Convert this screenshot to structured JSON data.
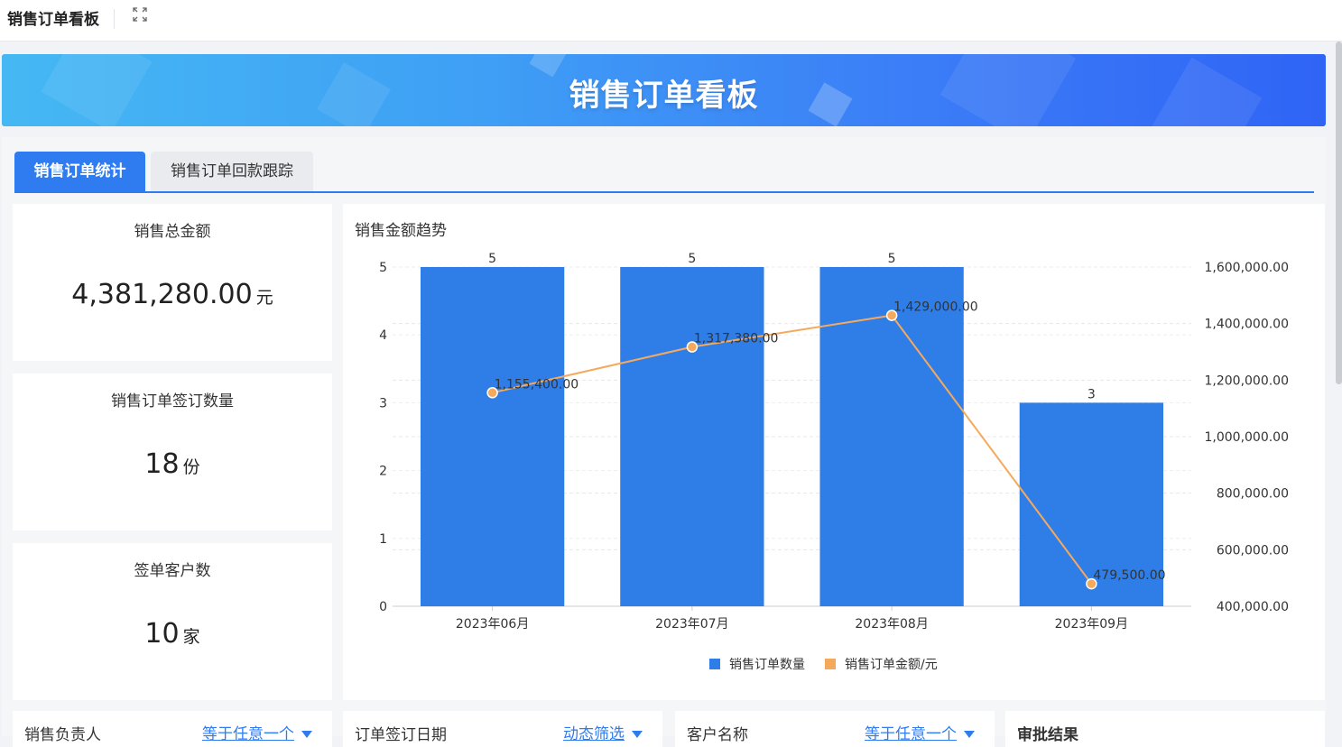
{
  "app_title": "销售订单看板",
  "banner_title": "销售订单看板",
  "tabs": [
    {
      "label": "销售订单统计",
      "active": true
    },
    {
      "label": "销售订单回款跟踪",
      "active": false
    }
  ],
  "kpis": [
    {
      "label": "销售总金额",
      "value": "4,381,280.00",
      "unit": "元"
    },
    {
      "label": "销售订单签订数量",
      "value": "18",
      "unit": "份"
    },
    {
      "label": "签单客户数",
      "value": "10",
      "unit": "家"
    }
  ],
  "chart_title": "销售金额趋势",
  "chart_data": {
    "type": "bar",
    "title": "销售金额趋势",
    "categories": [
      "2023年06月",
      "2023年07月",
      "2023年08月",
      "2023年09月"
    ],
    "series": [
      {
        "name": "销售订单数量",
        "type": "bar",
        "axis": "left",
        "values": [
          5,
          5,
          5,
          3
        ],
        "labels": [
          "5",
          "5",
          "5",
          "3"
        ],
        "color": "#2f7ee8"
      },
      {
        "name": "销售订单金额/元",
        "type": "line",
        "axis": "right",
        "values": [
          1155400,
          1317380,
          1429000,
          479500
        ],
        "labels": [
          "1,155,400.00",
          "1,317,380.00",
          "1,429,000.00",
          "479,500.00"
        ],
        "color": "#f5a95c"
      }
    ],
    "left_axis": {
      "ylim": [
        0,
        5
      ],
      "ticks": [
        "0",
        "1",
        "2",
        "3",
        "4",
        "5"
      ]
    },
    "right_axis": {
      "ylim": [
        400000,
        1600000
      ],
      "ticks": [
        "400,000.00",
        "600,000.00",
        "800,000.00",
        "1,000,000.00",
        "1,200,000.00",
        "1,400,000.00",
        "1,600,000.00"
      ]
    },
    "legend_position": "bottom-center",
    "grid": true
  },
  "filters": [
    {
      "label": "销售负责人",
      "value": "等于任意一个"
    },
    {
      "label": "订单签订日期",
      "value": "动态筛选"
    },
    {
      "label": "客户名称",
      "value": "等于任意一个"
    },
    {
      "label": "审批结果",
      "value": ""
    }
  ],
  "colors": {
    "accent": "#2f7cf0",
    "bar": "#2f7ee8",
    "line": "#f5a95c"
  }
}
